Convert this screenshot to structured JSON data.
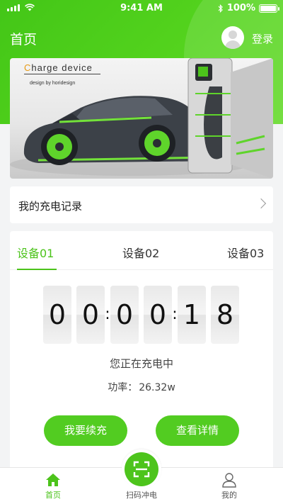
{
  "status_bar": {
    "time": "9:41 AM",
    "battery": "100%"
  },
  "nav": {
    "title": "首页",
    "login_label": "登录"
  },
  "banner": {
    "brand_c": "C",
    "brand_rest": "harge   device",
    "subtitle": "design by horidesign"
  },
  "records": {
    "label": "我的充电记录"
  },
  "devices": {
    "tabs": [
      "设备01",
      "设备02",
      "设备03"
    ],
    "active_tab": 0,
    "timer_digits": [
      "0",
      "0",
      "0",
      "0",
      "1",
      "8"
    ],
    "timer_separator": ":",
    "status": "您正在充电中",
    "power_label": "功率：",
    "power_value": "26.32w",
    "renew_button": "我要续充",
    "detail_button": "查看详情"
  },
  "tabbar": {
    "items": [
      {
        "label": "首页",
        "icon": "home-icon",
        "active": true
      },
      {
        "label": "扫码冲电",
        "icon": "scan-icon",
        "active": false
      },
      {
        "label": "我的",
        "icon": "user-icon",
        "active": false
      }
    ]
  },
  "colors": {
    "accent": "#4cc31b",
    "header": "#52cc21",
    "background": "#f3f4f5"
  }
}
